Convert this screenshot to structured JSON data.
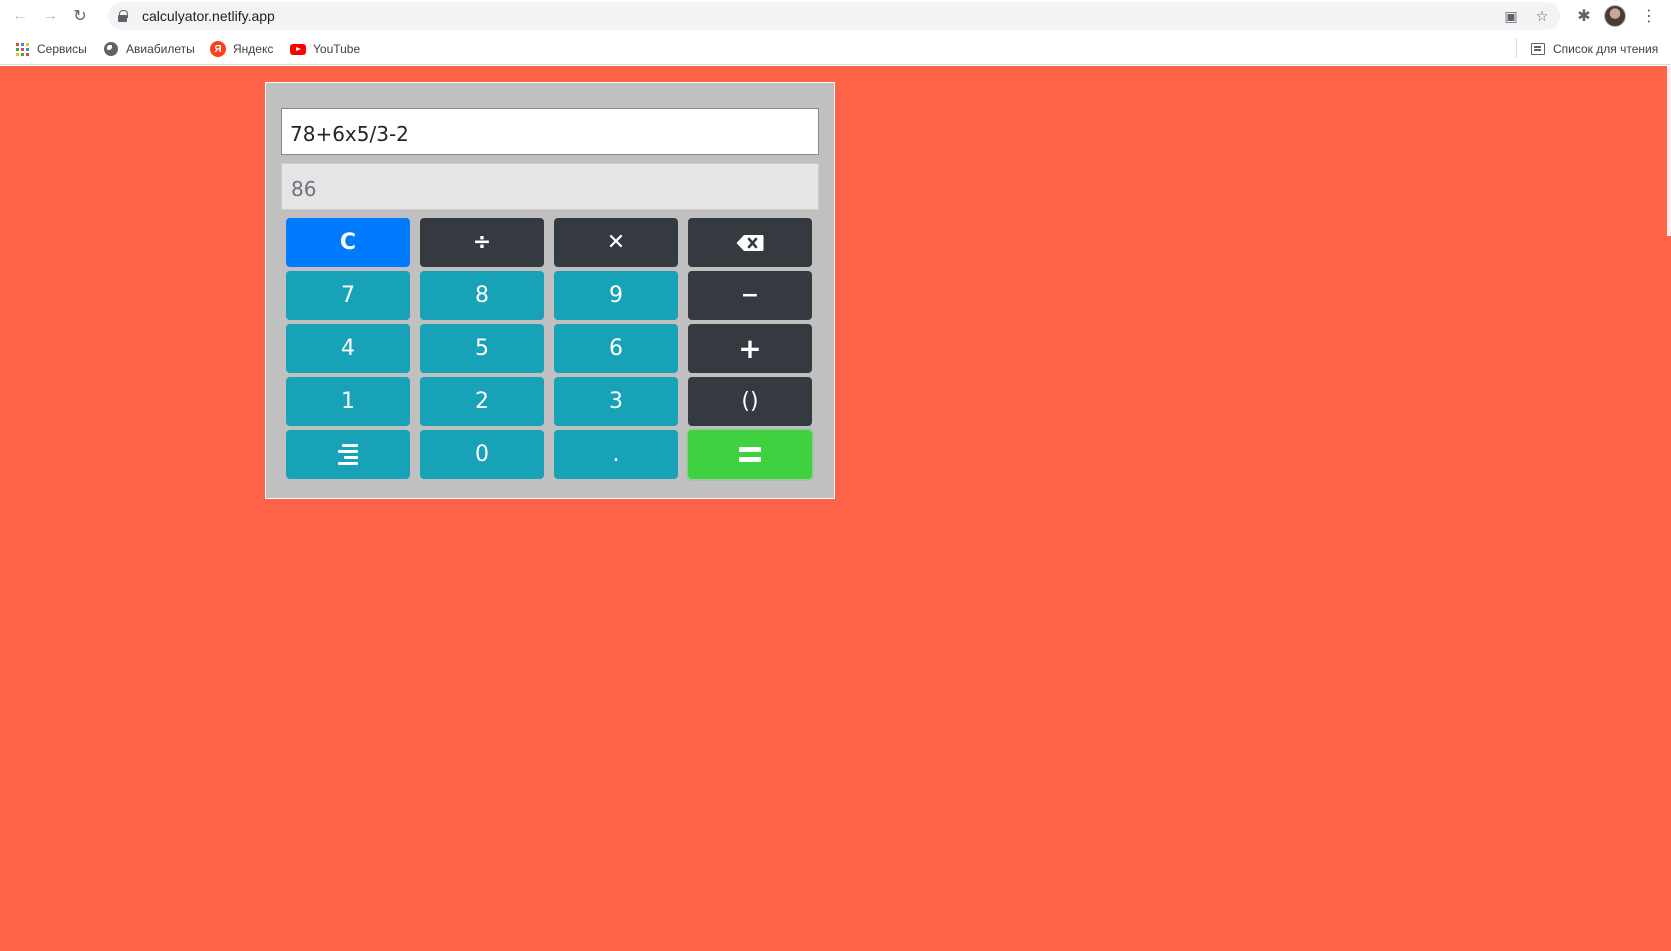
{
  "browser": {
    "url": "calculyator.netlify.app",
    "bookmarks": [
      {
        "label": "Сервисы",
        "icon": "apps-icon"
      },
      {
        "label": "Авиабилеты",
        "icon": "globe-icon"
      },
      {
        "label": "Яндекс",
        "icon": "yandex-icon"
      },
      {
        "label": "YouTube",
        "icon": "youtube-icon"
      }
    ],
    "reading_list": "Список для чтения",
    "yandex_letter": "Я"
  },
  "calculator": {
    "expression": "78+6x5/3-2",
    "result": "86",
    "keys": {
      "clear": "C",
      "divide": "÷",
      "multiply": "✕",
      "seven": "7",
      "eight": "8",
      "nine": "9",
      "minus": "−",
      "four": "4",
      "five": "5",
      "six": "6",
      "plus": "+",
      "one": "1",
      "two": "2",
      "three": "3",
      "parens": "()",
      "zero": "0",
      "dot": "."
    }
  },
  "colors": {
    "page_background": "#ff6347",
    "calculator_panel": "#c0c0c0",
    "number_key": "#17a2b8",
    "operator_key": "#343a40",
    "clear_key": "#007bff",
    "equals_key": "#3fd13f"
  }
}
